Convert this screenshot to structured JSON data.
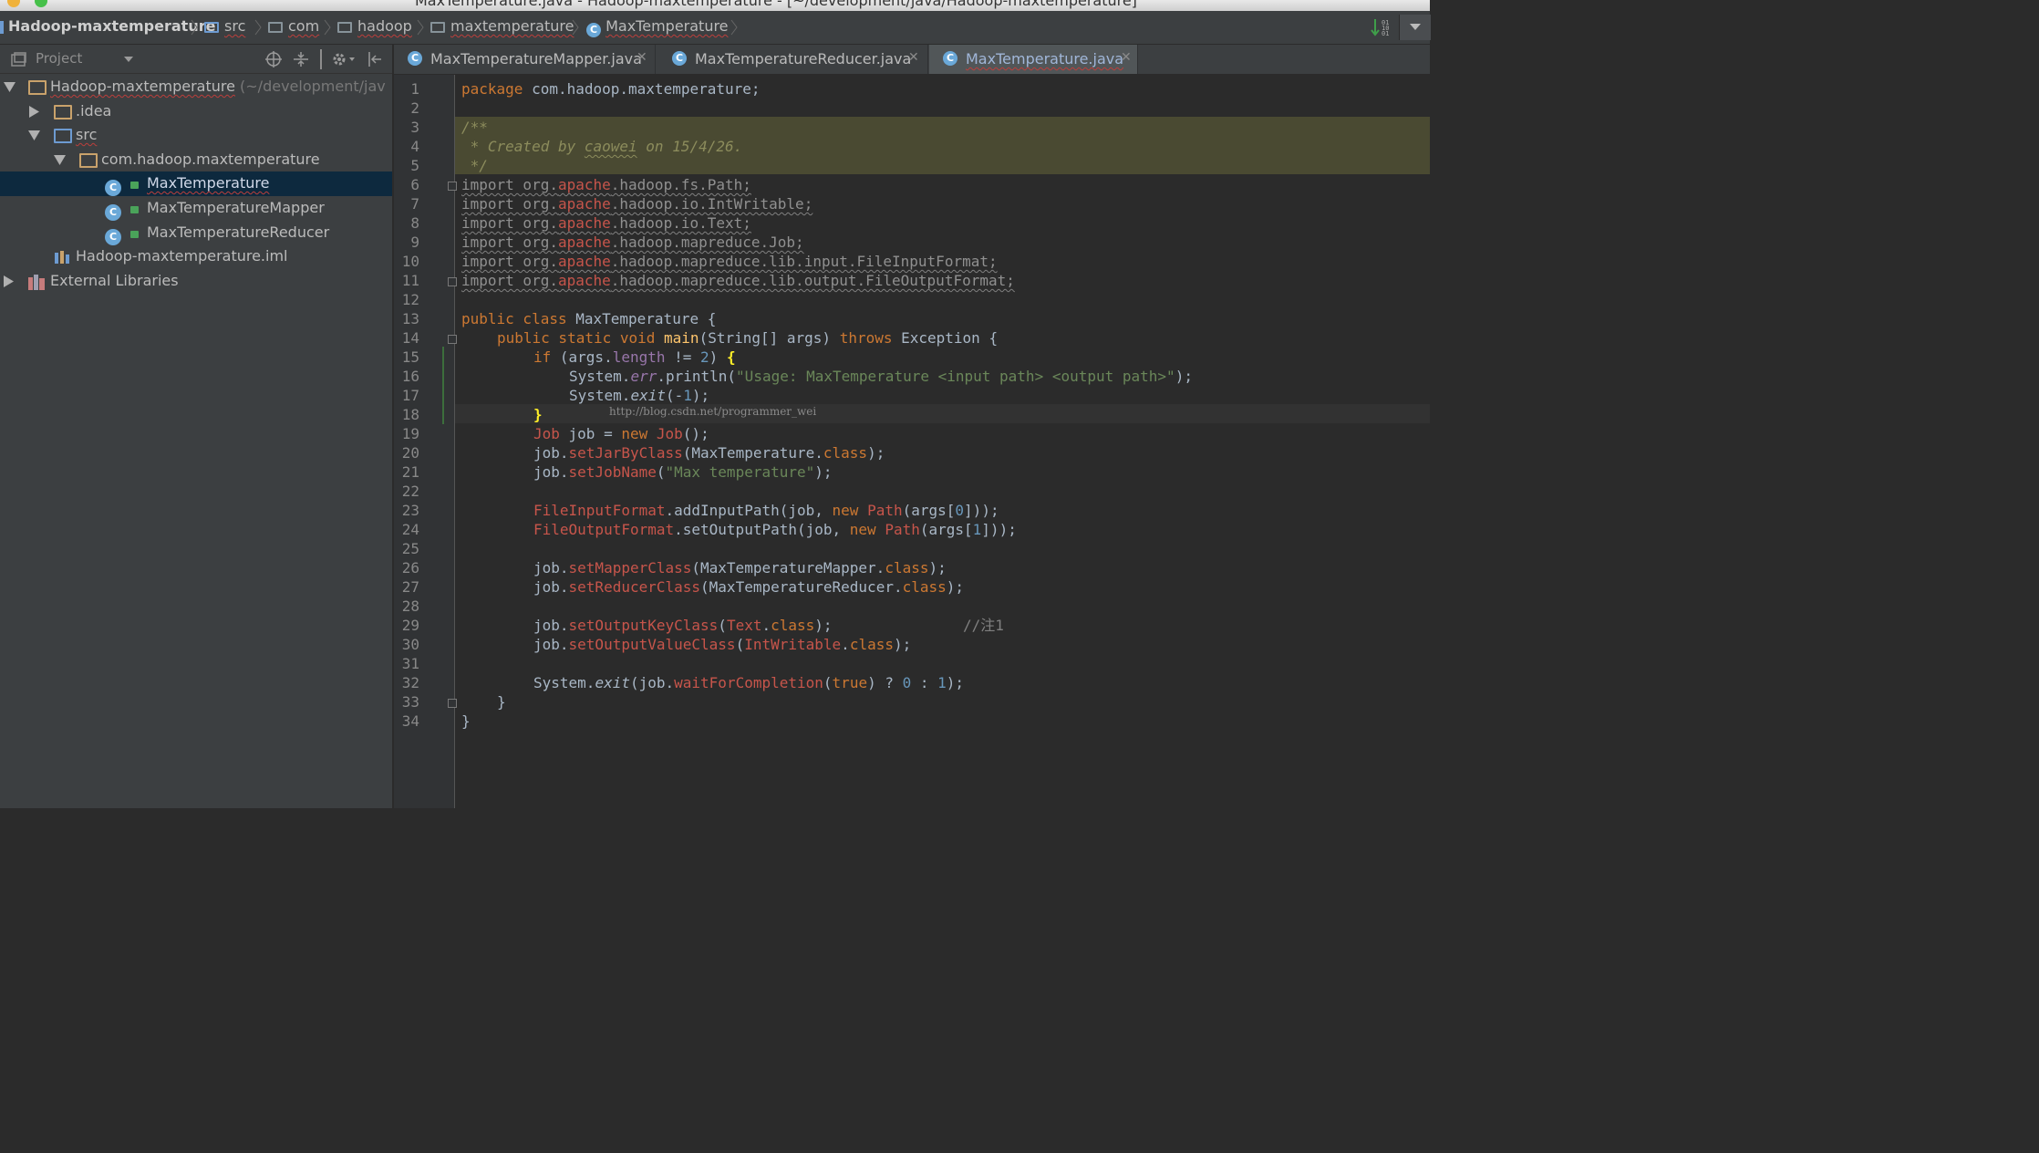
{
  "window": {
    "title": "MaxTemperature.java - Hadoop-maxtemperature - [~/development/java/Hadoop-maxtemperature]"
  },
  "breadcrumb": {
    "project": "Hadoop-maxtemperature",
    "items": [
      "src",
      "com",
      "hadoop",
      "maxtemperature",
      "MaxTemperature"
    ]
  },
  "tool_window": {
    "label": "Project"
  },
  "tree": {
    "root_label": "Hadoop-maxtemperature",
    "root_hint": "(~/development/jav",
    "idea": ".idea",
    "src": "src",
    "package": "com.hadoop.maxtemperature",
    "classes": [
      "MaxTemperature",
      "MaxTemperatureMapper",
      "MaxTemperatureReducer"
    ],
    "iml": "Hadoop-maxtemperature.iml",
    "external": "External Libraries"
  },
  "tabs": [
    {
      "label": "MaxTemperatureMapper.java"
    },
    {
      "label": "MaxTemperatureReducer.java"
    },
    {
      "label": "MaxTemperature.java"
    }
  ],
  "editor": {
    "line_numbers": [
      "1",
      "2",
      "3",
      "4",
      "5",
      "6",
      "7",
      "8",
      "9",
      "10",
      "11",
      "12",
      "13",
      "14",
      "15",
      "16",
      "17",
      "18",
      "19",
      "20",
      "21",
      "22",
      "23",
      "24",
      "25",
      "26",
      "27",
      "28",
      "29",
      "30",
      "31",
      "32",
      "33",
      "34"
    ],
    "watermark": "http://blog.csdn.net/programmer_wei",
    "code": {
      "l1a": "package",
      "l1b": " com.hadoop.maxtemperature;",
      "l3": "/**",
      "l4a": " * Created by ",
      "l4b": "caowei",
      "l4c": " on 15/4/26.",
      "l5": " */",
      "l6a": "import org.",
      "l6b": "apache",
      "l6c": ".hadoop.fs.Path;",
      "l7a": "import org.",
      "l7b": "apache",
      "l7c": ".hadoop.io.IntWritable;",
      "l8a": "import org.",
      "l8b": "apache",
      "l8c": ".hadoop.io.Text;",
      "l9a": "import org.",
      "l9b": "apache",
      "l9c": ".hadoop.mapreduce.Job;",
      "l10a": "import org.",
      "l10b": "apache",
      "l10c": ".hadoop.mapreduce.lib.input.FileInputFormat;",
      "l11a": "import org.",
      "l11b": "apache",
      "l11c": ".hadoop.mapreduce.lib.output.FileOutputFormat;",
      "l13a": "public class",
      "l13b": " MaxTemperature {",
      "l14a": "public static void",
      "l14b": "main",
      "l14c": "(String[] args) ",
      "l14d": "throws",
      "l14e": " Exception {",
      "l15a": "if",
      "l15b": " (args.",
      "l15c": "length",
      "l15d": " != ",
      "l15e": "2",
      "l15f": ") ",
      "l15g": "{",
      "l16a": "System.",
      "l16b": "err",
      "l16c": ".println(",
      "l16d": "\"Usage: MaxTemperature <input path> <output path>\"",
      "l16e": ");",
      "l17a": "System.",
      "l17b": "exit",
      "l17c": "(-",
      "l17d": "1",
      "l17e": ");",
      "l18": "}",
      "l19a": "Job",
      "l19b": " job = ",
      "l19c": "new",
      "l19d": " ",
      "l19e": "Job",
      "l19f": "();",
      "l20a": "job.",
      "l20b": "setJarByClass",
      "l20c": "(MaxTemperature.",
      "l20d": "class",
      "l20e": ");",
      "l21a": "job.",
      "l21b": "setJobName",
      "l21c": "(",
      "l21d": "\"Max temperature\"",
      "l21e": ");",
      "l23a": "FileInputFormat",
      "l23b": ".addInputPath(job, ",
      "l23c": "new",
      "l23d": " ",
      "l23e": "Path",
      "l23f": "(args[",
      "l23g": "0",
      "l23h": "]));",
      "l24a": "FileOutputFormat",
      "l24b": ".setOutputPath(job, ",
      "l24c": "new",
      "l24d": " ",
      "l24e": "Path",
      "l24f": "(args[",
      "l24g": "1",
      "l24h": "]));",
      "l26a": "job.",
      "l26b": "setMapperClass",
      "l26c": "(MaxTemperatureMapper.",
      "l26d": "class",
      "l26e": ");",
      "l27a": "job.",
      "l27b": "setReducerClass",
      "l27c": "(MaxTemperatureReducer.",
      "l27d": "class",
      "l27e": ");",
      "l29a": "job.",
      "l29b": "setOutputKeyClass",
      "l29c": "(",
      "l29d": "Text",
      "l29e": ".",
      "l29f": "class",
      "l29g": ");",
      "l29h": "//注1",
      "l30a": "job.",
      "l30b": "setOutputValueClass",
      "l30c": "(",
      "l30d": "IntWritable",
      "l30e": ".",
      "l30f": "class",
      "l30g": ");",
      "l32a": "System.",
      "l32b": "exit",
      "l32c": "(job.",
      "l32d": "waitForCompletion",
      "l32e": "(",
      "l32f": "true",
      "l32g": ") ? ",
      "l32h": "0",
      "l32i": " : ",
      "l32j": "1",
      "l32k": ");",
      "l33": "}",
      "l34": "}"
    }
  }
}
